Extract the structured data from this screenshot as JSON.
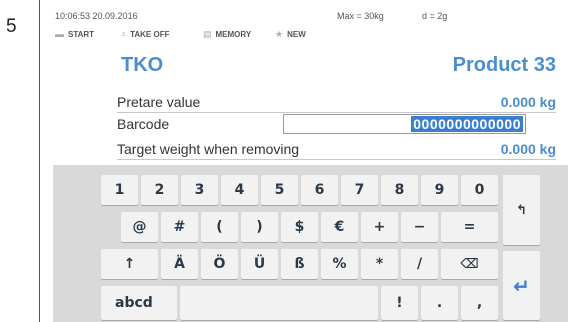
{
  "step_number": "5",
  "status": {
    "time": "10:06:53 20.09.2016",
    "max": "Max = 30kg",
    "d": "d = 2g"
  },
  "toolbar": {
    "start": "START",
    "takeoff": "TAKE OFF",
    "memory": "MEMORY",
    "new": "NEW"
  },
  "header": {
    "left_title": "TKO",
    "right_title": "Product 33"
  },
  "fields": {
    "pretare_label": "Pretare value",
    "pretare_value": "0.000 kg",
    "barcode_label": "Barcode",
    "barcode_value": "0000000000000",
    "target_label": "Target weight when removing",
    "target_value": "0.000 kg"
  },
  "keyboard": {
    "row1": [
      "1",
      "2",
      "3",
      "4",
      "5",
      "6",
      "7",
      "8",
      "9",
      "0"
    ],
    "row2": [
      "@",
      "#",
      "(",
      ")",
      "$",
      "€",
      "+",
      "−",
      "="
    ],
    "row3": [
      "↑",
      "Ä",
      "Ö",
      "Ü",
      "ß",
      "%",
      "*",
      "/"
    ],
    "backspace": "⌫",
    "shift_back": "↰",
    "abcd": "abcd",
    "space": "",
    "row4": [
      "!",
      ".",
      ","
    ],
    "enter": "↵"
  },
  "colors": {
    "accent": "#4a8ed0",
    "selection": "#3b80d0",
    "keyboard_bg": "#d9d9d9",
    "key_bg": "#f2f2f2"
  }
}
